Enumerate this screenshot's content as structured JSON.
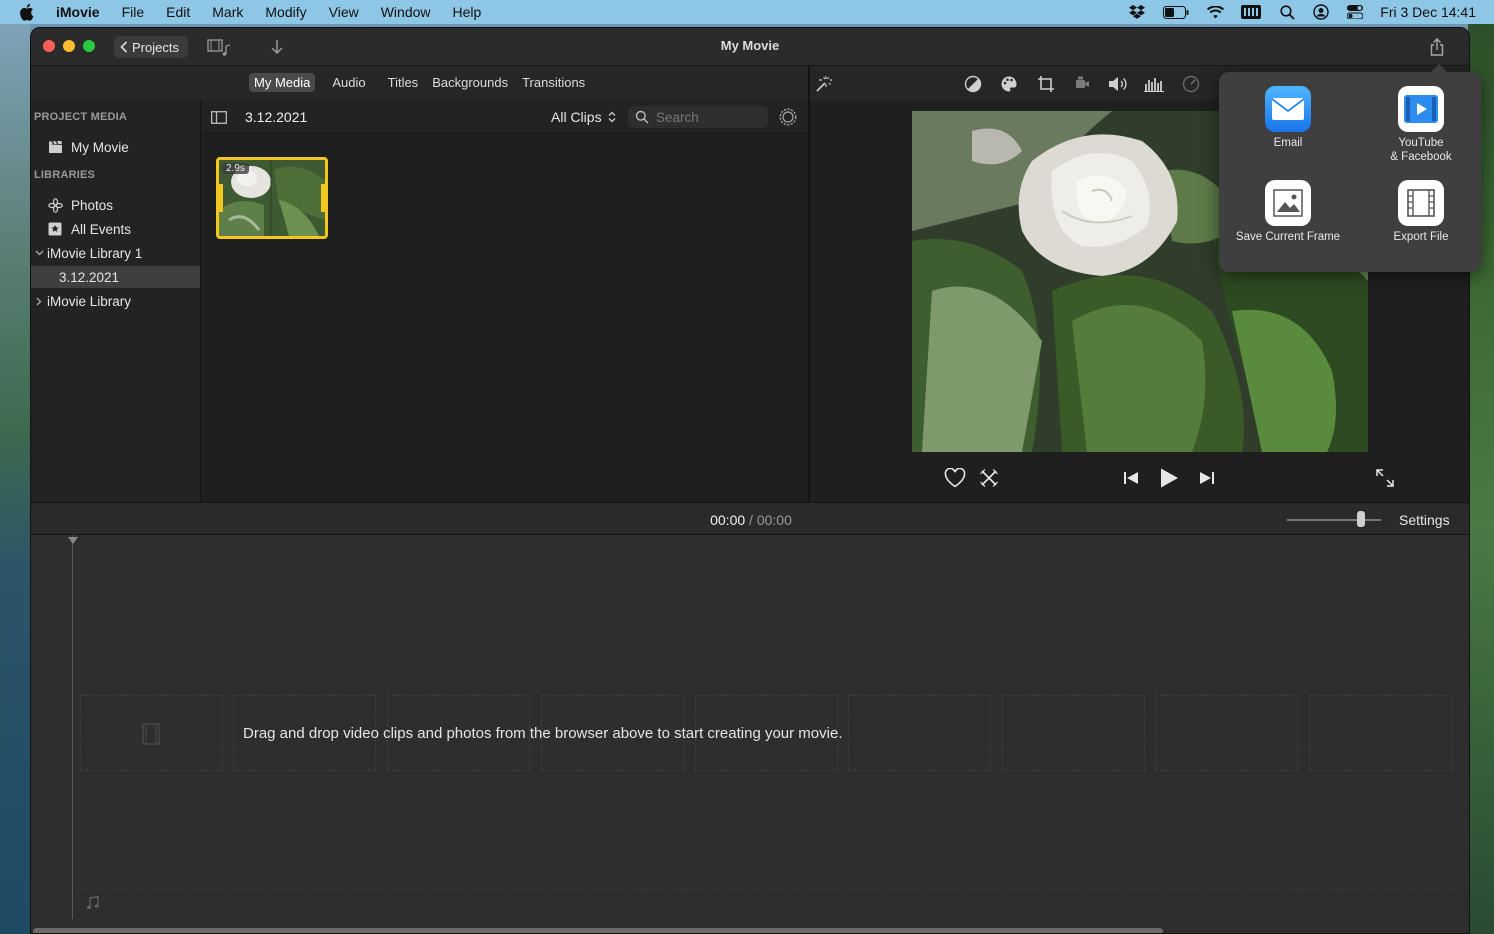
{
  "menubar": {
    "app_name": "iMovie",
    "items": [
      "File",
      "Edit",
      "Mark",
      "Modify",
      "View",
      "Window",
      "Help"
    ],
    "clock": "Fri 3 Dec  14:41",
    "icons": [
      "dropbox-icon",
      "battery-icon",
      "wifi-icon",
      "keyboard-icon",
      "spotlight-icon",
      "user-icon",
      "control-center-icon"
    ]
  },
  "window": {
    "title": "My Movie",
    "projects_label": "Projects"
  },
  "media_tabs": {
    "items": [
      "My Media",
      "Audio",
      "Titles",
      "Backgrounds",
      "Transitions"
    ],
    "active": "My Media"
  },
  "sidebar": {
    "project_header": "PROJECT MEDIA",
    "project_item": "My Movie",
    "libraries_header": "LIBRARIES",
    "items": [
      {
        "label": "Photos"
      },
      {
        "label": "All Events"
      },
      {
        "label": "iMovie Library 1"
      },
      {
        "label": "3.12.2021"
      },
      {
        "label": "iMovie Library"
      }
    ]
  },
  "browser": {
    "event_title": "3.12.2021",
    "filter": "All Clips",
    "search_placeholder": "Search",
    "clip_duration": "2.9s"
  },
  "timeline": {
    "current_time": "00:00",
    "separator": "/",
    "duration": "00:00",
    "settings_label": "Settings",
    "empty_message": "Drag and drop video clips and photos from the browser above to start creating your movie."
  },
  "share_popover": {
    "items": [
      {
        "label": "Email",
        "icon": "mail-icon"
      },
      {
        "label": "YouTube",
        "label2": "& Facebook",
        "icon": "youtube-icon"
      },
      {
        "label": "Save Current Frame",
        "icon": "image-icon"
      },
      {
        "label": "Export File",
        "icon": "film-icon"
      }
    ]
  },
  "colors": {
    "accent_yellow": "#f3c621",
    "window_bg": "#1f1f1f",
    "menubar_bg": "#8ec7e6"
  }
}
